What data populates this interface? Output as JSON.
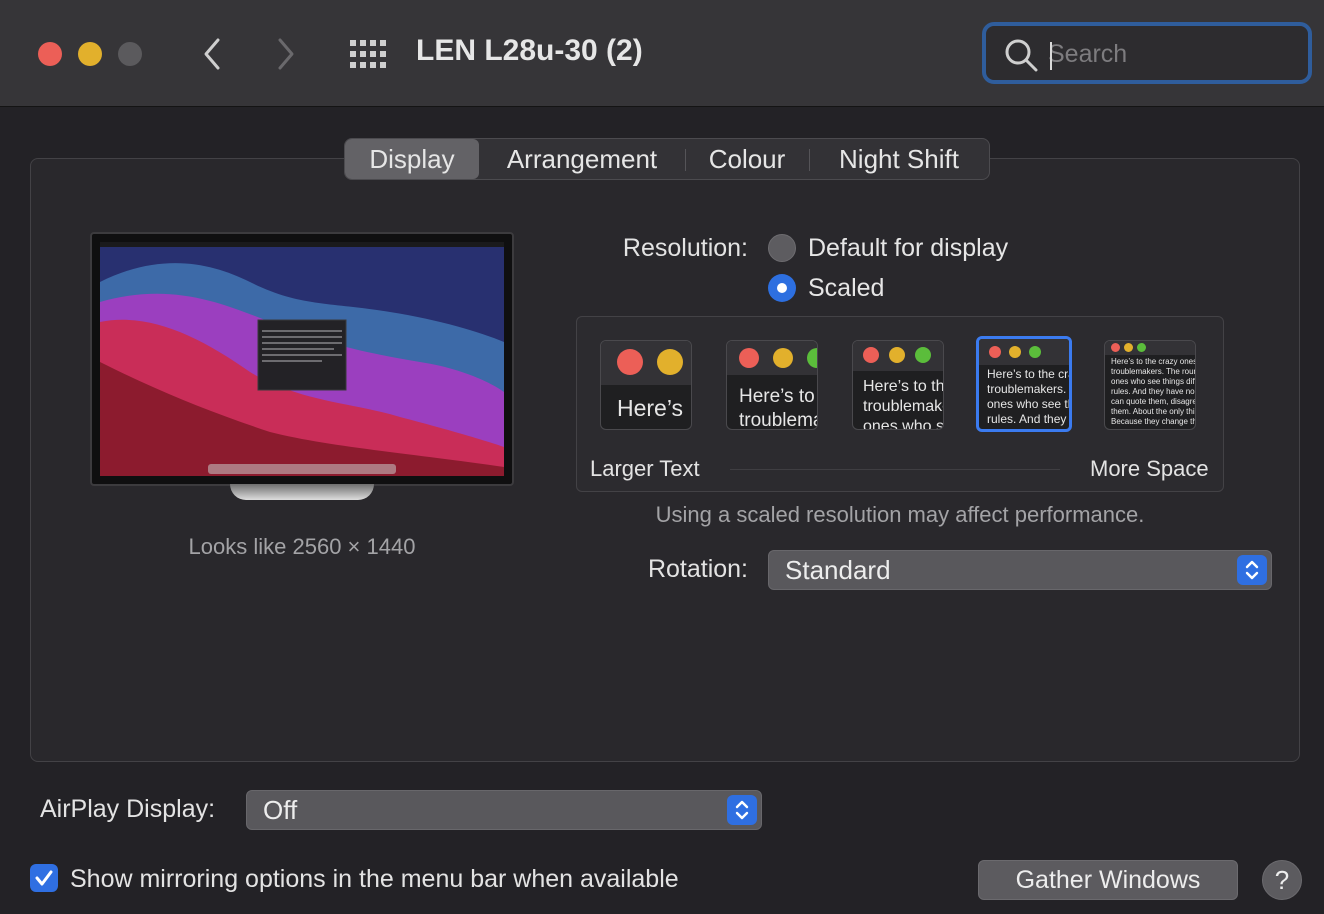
{
  "window": {
    "title": "LEN L28u-30 (2)",
    "search_placeholder": "Search"
  },
  "tabs": [
    {
      "label": "Display",
      "active": true
    },
    {
      "label": "Arrangement",
      "active": false
    },
    {
      "label": "Colour",
      "active": false
    },
    {
      "label": "Night Shift",
      "active": false
    }
  ],
  "display": {
    "looks_like": "Looks like 2560 × 1440",
    "resolution_label": "Resolution:",
    "resolution_options": [
      {
        "label": "Default for display",
        "selected": false
      },
      {
        "label": "Scaled",
        "selected": true
      }
    ],
    "scale_options": [
      {
        "sample": "Here’s",
        "selected": false
      },
      {
        "sample": "Here’s to the crazy ones\ntroublemakers",
        "selected": false
      },
      {
        "sample": "Here’s to the crazy\ntroublemakers\nones who see",
        "selected": false
      },
      {
        "sample": "Here’s to the crazy ones\ntroublemakers. The\nones who see things\nrules. And they have",
        "selected": true
      },
      {
        "sample": "Here’s to the crazy ones\ntroublemakers. The round\nones who see things diff\nrules. And they have no\ncan quote them, disagree\nthem. About the only thing\nBecause they change thin",
        "selected": false
      }
    ],
    "larger_text_label": "Larger Text",
    "more_space_label": "More Space",
    "performance_note": "Using a scaled resolution may affect performance.",
    "rotation_label": "Rotation:",
    "rotation_value": "Standard"
  },
  "airplay": {
    "label": "AirPlay Display:",
    "value": "Off"
  },
  "mirroring": {
    "label": "Show mirroring options in the menu bar when available",
    "checked": true
  },
  "buttons": {
    "gather_windows": "Gather Windows",
    "help": "?"
  },
  "colors": {
    "accent": "#2f6fe2",
    "close": "#ec5f57",
    "minimize": "#e2b02c",
    "window_bg": "#232226"
  }
}
